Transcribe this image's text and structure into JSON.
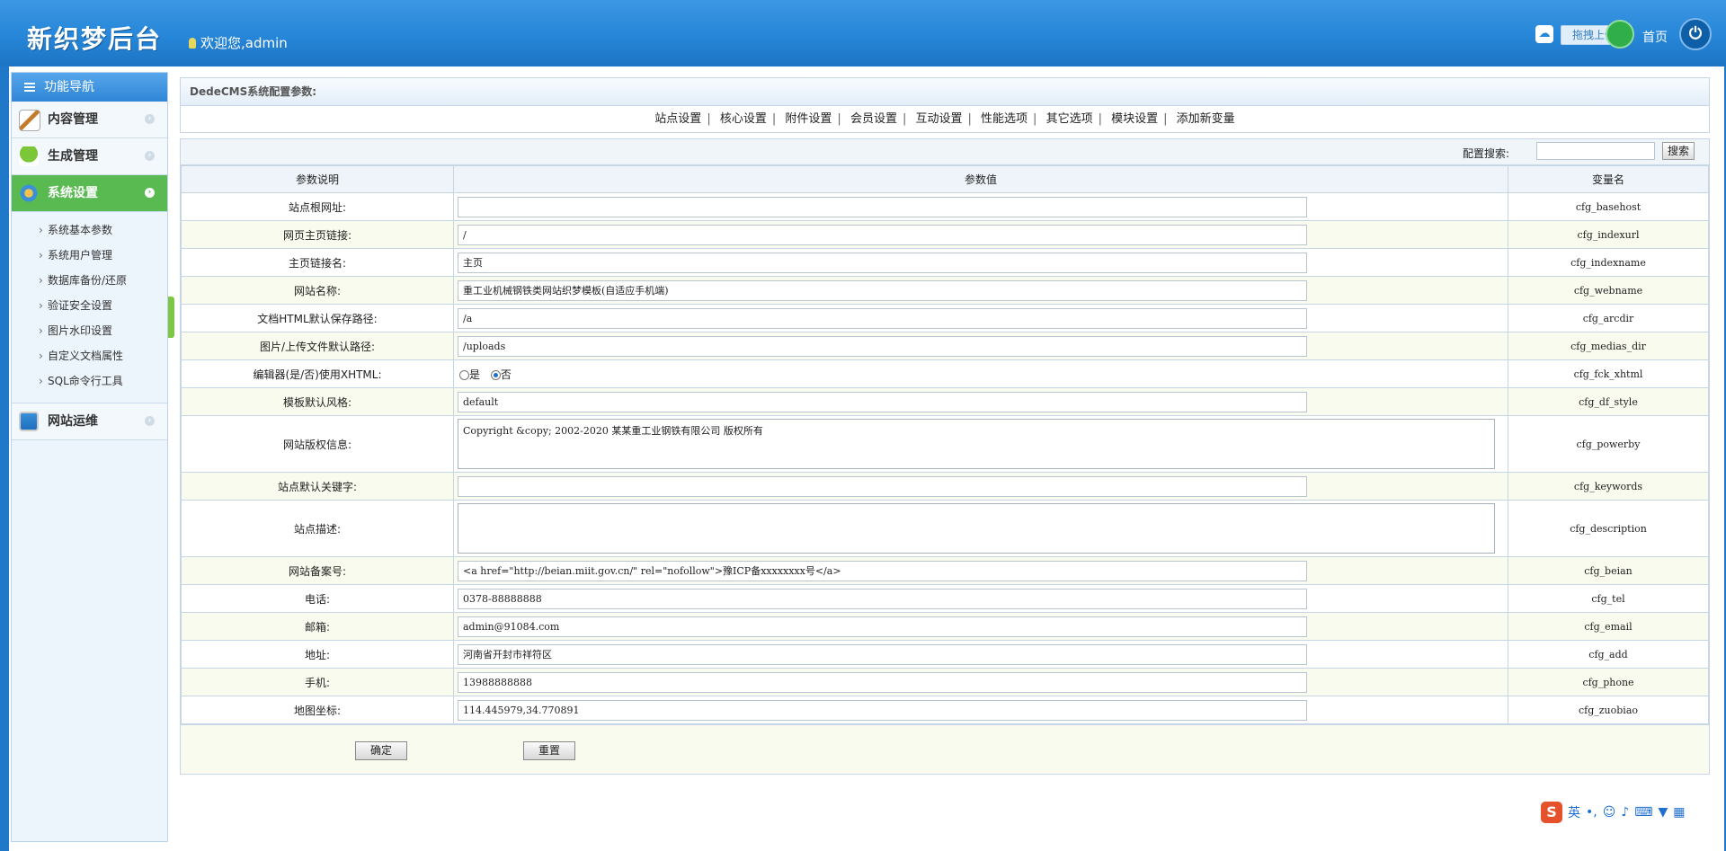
{
  "header": {
    "logo": "新织梦后台",
    "welcome": "欢迎您,admin",
    "upload_label": "拖拽上传",
    "home_label": "首页"
  },
  "sidebar": {
    "title": "功能导航",
    "menu": [
      {
        "label": "内容管理",
        "icon": "edit-icon"
      },
      {
        "label": "生成管理",
        "icon": "tree-icon"
      },
      {
        "label": "系统设置",
        "icon": "settings-icon"
      },
      {
        "label": "网站运维",
        "icon": "monitor-icon"
      }
    ],
    "submenu": [
      "系统基本参数",
      "系统用户管理",
      "数据库备份/还原",
      "验证安全设置",
      "图片水印设置",
      "自定义文档属性",
      "SQL命令行工具"
    ]
  },
  "main": {
    "header": "DedeCMS系统配置参数:",
    "tabs": [
      "站点设置",
      "核心设置",
      "附件设置",
      "会员设置",
      "互动设置",
      "性能选项",
      "其它选项",
      "模块设置",
      "添加新变量"
    ],
    "search_label": "配置搜索:",
    "search_button": "搜索",
    "columns": [
      "参数说明",
      "参数值",
      "变量名"
    ],
    "rows": [
      {
        "label": "站点根网址:",
        "value": "",
        "var": "cfg_basehost"
      },
      {
        "label": "网页主页链接:",
        "value": "/",
        "var": "cfg_indexurl"
      },
      {
        "label": "主页链接名:",
        "value": "主页",
        "var": "cfg_indexname"
      },
      {
        "label": "网站名称:",
        "value": "重工业机械钢铁类网站织梦模板(自适应手机端)",
        "var": "cfg_webname"
      },
      {
        "label": "文档HTML默认保存路径:",
        "value": "/a",
        "var": "cfg_arcdir"
      },
      {
        "label": "图片/上传文件默认路径:",
        "value": "/uploads",
        "var": "cfg_medias_dir"
      },
      {
        "label": "编辑器(是/否)使用XHTML:",
        "radio_yes": "是",
        "radio_no": "否",
        "var": "cfg_fck_xhtml"
      },
      {
        "label": "模板默认风格:",
        "value": "default",
        "var": "cfg_df_style"
      },
      {
        "label": "网站版权信息:",
        "value": "Copyright &copy; 2002-2020 某某重工业钢铁有限公司 版权所有",
        "var": "cfg_powerby"
      },
      {
        "label": "站点默认关键字:",
        "value": "",
        "var": "cfg_keywords"
      },
      {
        "label": "站点描述:",
        "value": "",
        "var": "cfg_description"
      },
      {
        "label": "网站备案号:",
        "value": "<a href=\"http://beian.miit.gov.cn/\" rel=\"nofollow\">豫ICP备xxxxxxxx号</a>",
        "var": "cfg_beian"
      },
      {
        "label": "电话:",
        "value": "0378-88888888",
        "var": "cfg_tel"
      },
      {
        "label": "邮箱:",
        "value": "admin@91084.com",
        "var": "cfg_email"
      },
      {
        "label": "地址:",
        "value": "河南省开封市祥符区",
        "var": "cfg_add"
      },
      {
        "label": "手机:",
        "value": "13988888888",
        "var": "cfg_phone"
      },
      {
        "label": "地图坐标:",
        "value": "114.445979,34.770891",
        "var": "cfg_zuobiao"
      }
    ],
    "confirm_button": "确定",
    "reset_button": "重置"
  },
  "ime": {
    "mode": "英"
  }
}
